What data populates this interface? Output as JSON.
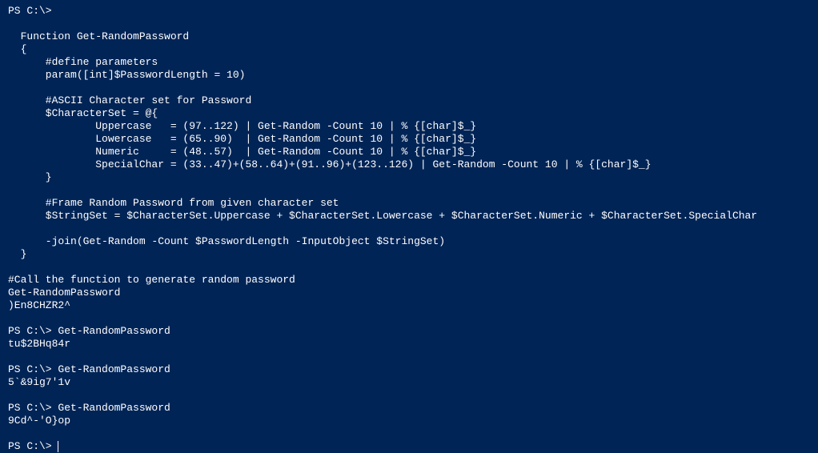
{
  "terminal": {
    "lines": [
      "PS C:\\>",
      "",
      "  Function Get-RandomPassword",
      "  {",
      "      #define parameters",
      "      param([int]$PasswordLength = 10)",
      "",
      "      #ASCII Character set for Password",
      "      $CharacterSet = @{",
      "              Uppercase   = (97..122) | Get-Random -Count 10 | % {[char]$_}",
      "              Lowercase   = (65..90)  | Get-Random -Count 10 | % {[char]$_}",
      "              Numeric     = (48..57)  | Get-Random -Count 10 | % {[char]$_}",
      "              SpecialChar = (33..47)+(58..64)+(91..96)+(123..126) | Get-Random -Count 10 | % {[char]$_}",
      "      }",
      "",
      "      #Frame Random Password from given character set",
      "      $StringSet = $CharacterSet.Uppercase + $CharacterSet.Lowercase + $CharacterSet.Numeric + $CharacterSet.SpecialChar",
      "",
      "      -join(Get-Random -Count $PasswordLength -InputObject $StringSet)",
      "  }",
      "",
      "#Call the function to generate random password",
      "Get-RandomPassword",
      ")En8CHZR2^",
      "",
      "PS C:\\> Get-RandomPassword",
      "tu$2BHq84r",
      "",
      "PS C:\\> Get-RandomPassword",
      "5`&9ig7'1v",
      "",
      "PS C:\\> Get-RandomPassword",
      "9Cd^-'O}op",
      "",
      "PS C:\\> "
    ]
  }
}
